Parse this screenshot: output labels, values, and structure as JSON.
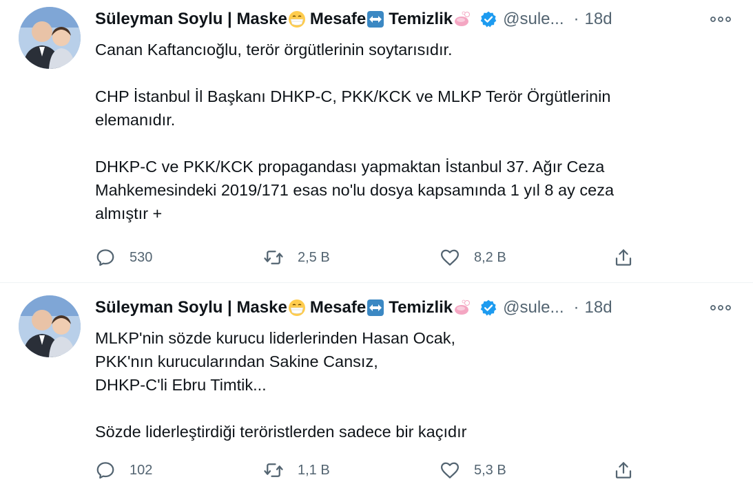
{
  "tweets": [
    {
      "author": {
        "name_part1": "Süleyman Soylu | Maske",
        "name_part2": "Mesafe",
        "name_part3": "Temizlik",
        "handle": "@sule...",
        "time": "18d"
      },
      "body": [
        "Canan Kaftancıoğlu, terör örgütlerinin soytarısıdır.",
        "",
        "CHP İstanbul İl Başkanı DHKP-C, PKK/KCK ve MLKP Terör Örgütlerinin",
        "elemanıdır.",
        "",
        "DHKP-C ve PKK/KCK propagandası yapmaktan İstanbul 37. Ağır Ceza",
        "Mahkemesindeki 2019/171 esas no'lu dosya kapsamında 1 yıl 8 ay ceza",
        "almıştır +"
      ],
      "stats": {
        "replies": "530",
        "retweets": "2,5 B",
        "likes": "8,2 B"
      }
    },
    {
      "author": {
        "name_part1": "Süleyman Soylu | Maske",
        "name_part2": "Mesafe",
        "name_part3": "Temizlik",
        "handle": "@sule...",
        "time": "18d"
      },
      "body": [
        "MLKP'nin sözde kurucu liderlerinden Hasan Ocak,",
        "PKK'nın kurucularından Sakine Cansız,",
        "DHKP-C'li Ebru Timtik...",
        "",
        "Sözde liderleştirdiği teröristlerden sadece bir kaçıdır"
      ],
      "stats": {
        "replies": "102",
        "retweets": "1,1 B",
        "likes": "5,3 B"
      }
    }
  ],
  "icons": {
    "mask": "face-with-medical-mask-emoji",
    "arrows": "left-right-arrow-emoji",
    "soap": "soap-emoji",
    "verified": "verified-badge-icon",
    "more": "more-options-icon",
    "reply": "reply-icon",
    "retweet": "retweet-icon",
    "like": "like-icon",
    "share": "share-icon"
  },
  "colors": {
    "verified": "#1d9bf0",
    "secondary_text": "#536471",
    "thread_line": "#cfd9de",
    "arrow_emoji": "#3b88c3",
    "soap_emoji": "#f4a6c2"
  }
}
